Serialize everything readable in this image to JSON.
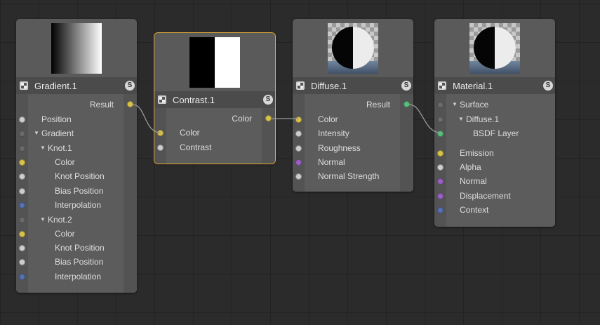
{
  "colors": {
    "yellow": "#d9c24a",
    "white": "#cdcdcd",
    "blue": "#5571b3",
    "purple": "#9a60c4",
    "green": "#56bf7a",
    "dim": "#6a6a6a",
    "selected_outline": "#e0a935"
  },
  "nodes": {
    "gradient": {
      "title": "Gradient.1",
      "s_badge": "S",
      "output": "Result",
      "inputs": [
        "Position",
        "Gradient",
        "Knot.1",
        "Color",
        "Knot Position",
        "Bias Position",
        "Interpolation",
        "Knot.2",
        "Color",
        "Knot Position",
        "Bias Position",
        "Interpolation"
      ]
    },
    "contrast": {
      "title": "Contrast.1",
      "s_badge": "S",
      "output": "Color",
      "inputs": [
        "Color",
        "Contrast"
      ]
    },
    "diffuse": {
      "title": "Diffuse.1",
      "s_badge": "S",
      "output": "Result",
      "inputs": [
        "Color",
        "Intensity",
        "Roughness",
        "Normal",
        "Normal Strength"
      ]
    },
    "material": {
      "title": "Material.1",
      "s_badge": "S",
      "inputs": [
        "Surface",
        "Diffuse.1",
        "BSDF Layer",
        "Emission",
        "Alpha",
        "Normal",
        "Displacement",
        "Context"
      ]
    }
  }
}
